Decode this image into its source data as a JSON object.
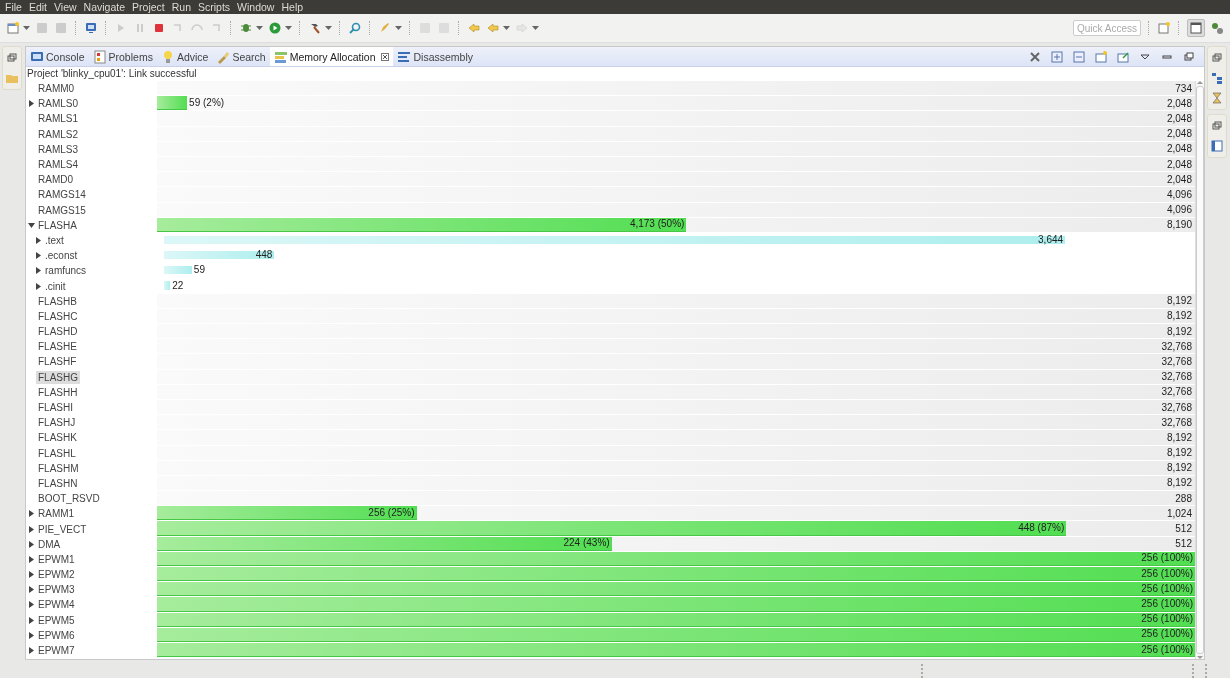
{
  "menu": [
    "File",
    "Edit",
    "View",
    "Navigate",
    "Project",
    "Run",
    "Scripts",
    "Window",
    "Help"
  ],
  "quick_access": {
    "placeholder": "Quick Access"
  },
  "tabs": [
    {
      "label": "Console",
      "selected": false
    },
    {
      "label": "Problems",
      "selected": false
    },
    {
      "label": "Advice",
      "selected": false
    },
    {
      "label": "Search",
      "selected": false
    },
    {
      "label": "Memory Allocation",
      "selected": true
    },
    {
      "label": "Disassembly",
      "selected": false
    }
  ],
  "status_line": "Project 'blinky_cpu01': Link successful",
  "rows": [
    {
      "name": "RAMM0",
      "selected": false,
      "total": "734"
    },
    {
      "name": "RAMLS0",
      "selected": false,
      "expanded": false,
      "usage": "59 (2%)",
      "level": 0.029,
      "total": "2,048"
    },
    {
      "name": "RAMLS1",
      "selected": false,
      "total": "2,048"
    },
    {
      "name": "RAMLS2",
      "selected": false,
      "total": "2,048"
    },
    {
      "name": "RAMLS3",
      "selected": false,
      "total": "2,048"
    },
    {
      "name": "RAMLS4",
      "selected": false,
      "total": "2,048"
    },
    {
      "name": "RAMD0",
      "selected": false,
      "total": "2,048"
    },
    {
      "name": "RAMGS14",
      "selected": false,
      "total": "4,096"
    },
    {
      "name": "RAMGS15",
      "selected": false,
      "total": "4,096"
    },
    {
      "name": "FLASHA",
      "selected": false,
      "expanded": true,
      "usage": "4,173 (50%)",
      "level": 0.51,
      "total": "8,190",
      "children": [
        {
          "name": ".text",
          "selected": false,
          "expanded": false,
          "usage": "3,644",
          "level": 0.874
        },
        {
          "name": ".econst",
          "selected": false,
          "expanded": false,
          "usage": "448",
          "level": 0.107
        },
        {
          "name": "ramfuncs",
          "selected": false,
          "expanded": false,
          "usage": "59",
          "level": 0.027
        },
        {
          "name": ".cinit",
          "selected": false,
          "expanded": false,
          "usage": "22",
          "level": 0.006
        }
      ]
    },
    {
      "name": "FLASHB",
      "selected": false,
      "total": "8,192"
    },
    {
      "name": "FLASHC",
      "selected": false,
      "total": "8,192"
    },
    {
      "name": "FLASHD",
      "selected": false,
      "total": "8,192"
    },
    {
      "name": "FLASHE",
      "selected": false,
      "total": "32,768"
    },
    {
      "name": "FLASHF",
      "selected": false,
      "total": "32,768"
    },
    {
      "name": "FLASHG",
      "selected": true,
      "total": "32,768"
    },
    {
      "name": "FLASHH",
      "selected": false,
      "total": "32,768"
    },
    {
      "name": "FLASHI",
      "selected": false,
      "total": "32,768"
    },
    {
      "name": "FLASHJ",
      "selected": false,
      "total": "32,768"
    },
    {
      "name": "FLASHK",
      "selected": false,
      "total": "8,192"
    },
    {
      "name": "FLASHL",
      "selected": false,
      "total": "8,192"
    },
    {
      "name": "FLASHM",
      "selected": false,
      "total": "8,192"
    },
    {
      "name": "FLASHN",
      "selected": false,
      "total": "8,192"
    },
    {
      "name": "BOOT_RSVD",
      "selected": false,
      "total": "288"
    },
    {
      "name": "RAMM1",
      "selected": false,
      "expanded": false,
      "usage": "256 (25%)",
      "level": 0.25,
      "total": "1,024"
    },
    {
      "name": "PIE_VECT",
      "selected": false,
      "expanded": false,
      "usage": "448 (87%)",
      "level": 0.876,
      "total": "512"
    },
    {
      "name": "DMA",
      "selected": false,
      "expanded": false,
      "usage": "224 (43%)",
      "level": 0.438,
      "total": "512"
    },
    {
      "name": "EPWM1",
      "selected": false,
      "expanded": false,
      "usage": "256 (100%)",
      "level": 1
    },
    {
      "name": "EPWM2",
      "selected": false,
      "expanded": false,
      "usage": "256 (100%)",
      "level": 1
    },
    {
      "name": "EPWM3",
      "selected": false,
      "expanded": false,
      "usage": "256 (100%)",
      "level": 1
    },
    {
      "name": "EPWM4",
      "selected": false,
      "expanded": false,
      "usage": "256 (100%)",
      "level": 1
    },
    {
      "name": "EPWM5",
      "selected": false,
      "expanded": false,
      "usage": "256 (100%)",
      "level": 1
    },
    {
      "name": "EPWM6",
      "selected": false,
      "expanded": false,
      "usage": "256 (100%)",
      "level": 1
    },
    {
      "name": "EPWM7",
      "selected": false,
      "expanded": false,
      "usage": "256 (100%)",
      "level": 1
    }
  ]
}
